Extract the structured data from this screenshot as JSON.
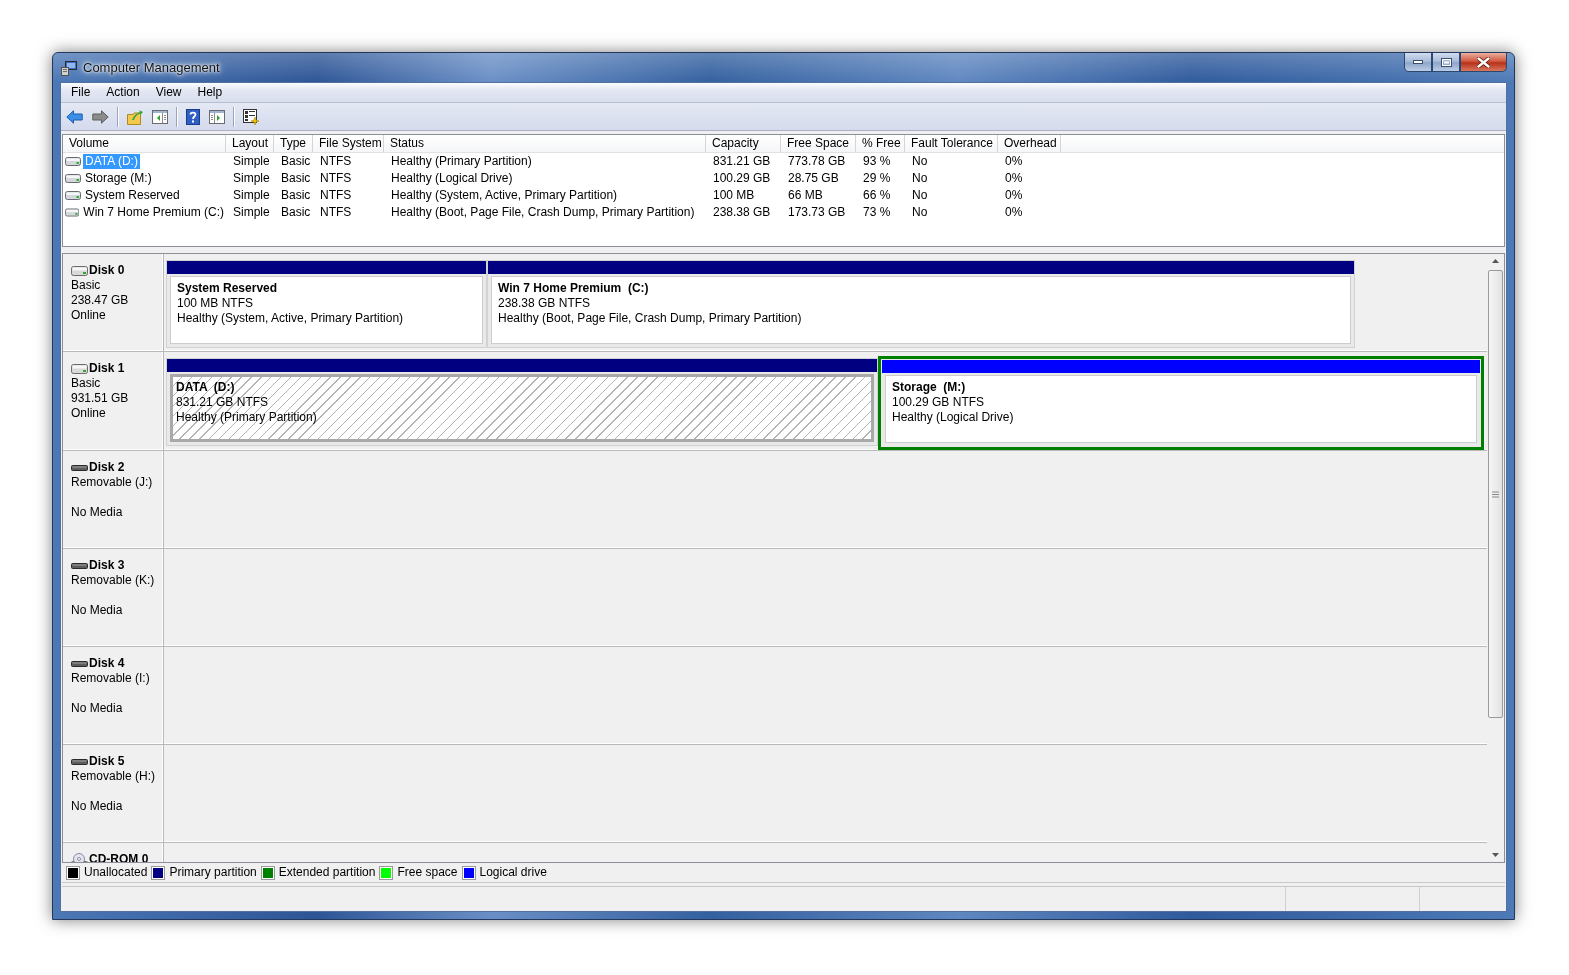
{
  "window": {
    "title": "Computer Management"
  },
  "menu": [
    "File",
    "Action",
    "View",
    "Help"
  ],
  "toolbar": [
    [
      {
        "kind": "back",
        "disabled": false
      },
      {
        "kind": "forward",
        "disabled": true
      }
    ],
    [
      {
        "kind": "up",
        "disabled": false
      },
      {
        "kind": "console-tree",
        "disabled": false
      }
    ],
    [
      {
        "kind": "help",
        "disabled": false
      },
      {
        "kind": "action-pane",
        "disabled": false
      }
    ],
    [
      {
        "kind": "wizard",
        "disabled": false
      }
    ]
  ],
  "volume_list": {
    "columns": [
      "Volume",
      "Layout",
      "Type",
      "File System",
      "Status",
      "Capacity",
      "Free Space",
      "% Free",
      "Fault Tolerance",
      "Overhead"
    ],
    "rows": [
      {
        "selected": true,
        "cells": [
          "DATA (D:)",
          "Simple",
          "Basic",
          "NTFS",
          "Healthy (Primary Partition)",
          "831.21 GB",
          "773.78 GB",
          "93 %",
          "No",
          "0%"
        ]
      },
      {
        "selected": false,
        "cells": [
          "Storage (M:)",
          "Simple",
          "Basic",
          "NTFS",
          "Healthy (Logical Drive)",
          "100.29 GB",
          "28.75 GB",
          "29 %",
          "No",
          "0%"
        ]
      },
      {
        "selected": false,
        "cells": [
          "System Reserved",
          "Simple",
          "Basic",
          "NTFS",
          "Healthy (System, Active, Primary Partition)",
          "100 MB",
          "66 MB",
          "66 %",
          "No",
          "0%"
        ]
      },
      {
        "selected": false,
        "cells": [
          "Win 7 Home Premium (C:)",
          "Simple",
          "Basic",
          "NTFS",
          "Healthy (Boot, Page File, Crash Dump, Primary Partition)",
          "238.38 GB",
          "173.73 GB",
          "73 %",
          "No",
          "0%"
        ]
      }
    ]
  },
  "disks": [
    {
      "name": "Disk 0",
      "kind": "basic",
      "type": "Basic",
      "size": "238.47 GB",
      "state": "Online",
      "partitions": [
        {
          "kind": "primary",
          "color": "#000080",
          "selected": false,
          "name": "System Reserved",
          "size": "100 MB NTFS",
          "status": "Healthy (System, Active, Primary Partition)"
        },
        {
          "kind": "primary",
          "color": "#000080",
          "selected": false,
          "name": "Win 7 Home Premium  (C:)",
          "size": "238.38 GB NTFS",
          "status": "Healthy (Boot, Page File, Crash Dump, Primary Partition)"
        }
      ]
    },
    {
      "name": "Disk 1",
      "kind": "basic",
      "type": "Basic",
      "size": "931.51 GB",
      "state": "Online",
      "partitions": [
        {
          "kind": "primary",
          "color": "#000080",
          "selected": true,
          "name": "DATA  (D:)",
          "size": "831.21 GB NTFS",
          "status": "Healthy (Primary Partition)"
        },
        {
          "kind": "logical",
          "color": "#0000ff",
          "selected": false,
          "name": "Storage  (M:)",
          "size": "100.29 GB NTFS",
          "status": "Healthy (Logical Drive)"
        }
      ]
    },
    {
      "name": "Disk 2",
      "kind": "removable",
      "type": "Removable (J:)",
      "state": "No Media"
    },
    {
      "name": "Disk 3",
      "kind": "removable",
      "type": "Removable (K:)",
      "state": "No Media"
    },
    {
      "name": "Disk 4",
      "kind": "removable",
      "type": "Removable (I:)",
      "state": "No Media"
    },
    {
      "name": "Disk 5",
      "kind": "removable",
      "type": "Removable (H:)",
      "state": "No Media"
    },
    {
      "name": "CD-ROM 0",
      "kind": "cdrom"
    }
  ],
  "legend": [
    {
      "label": "Unallocated",
      "color": "#000000"
    },
    {
      "label": "Primary partition",
      "color": "#000080"
    },
    {
      "label": "Extended partition",
      "color": "#008000"
    },
    {
      "label": "Free space",
      "color": "#00ff00"
    },
    {
      "label": "Logical drive",
      "color": "#0000ff"
    }
  ]
}
